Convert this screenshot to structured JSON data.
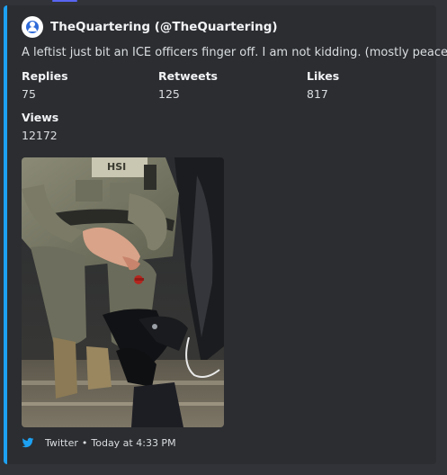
{
  "embed": {
    "accent_color": "#1da1f2",
    "author": {
      "name": "TheQuartering (@TheQuartering)",
      "avatar_icon": "avatar-icon"
    },
    "description": "A leftist just bit an ICE officers finger off. I am not kidding. (mostly peaceful)",
    "fields": [
      {
        "name": "Replies",
        "value": "75"
      },
      {
        "name": "Retweets",
        "value": "125"
      },
      {
        "name": "Likes",
        "value": "817"
      },
      {
        "name": "Views",
        "value": "12172"
      }
    ],
    "image": {
      "alt": "photo of an officer's bitten finger"
    },
    "footer": {
      "icon": "twitter-bird-icon",
      "source": "Twitter",
      "separator": "•",
      "timestamp": "Today at 4:33 PM"
    }
  }
}
